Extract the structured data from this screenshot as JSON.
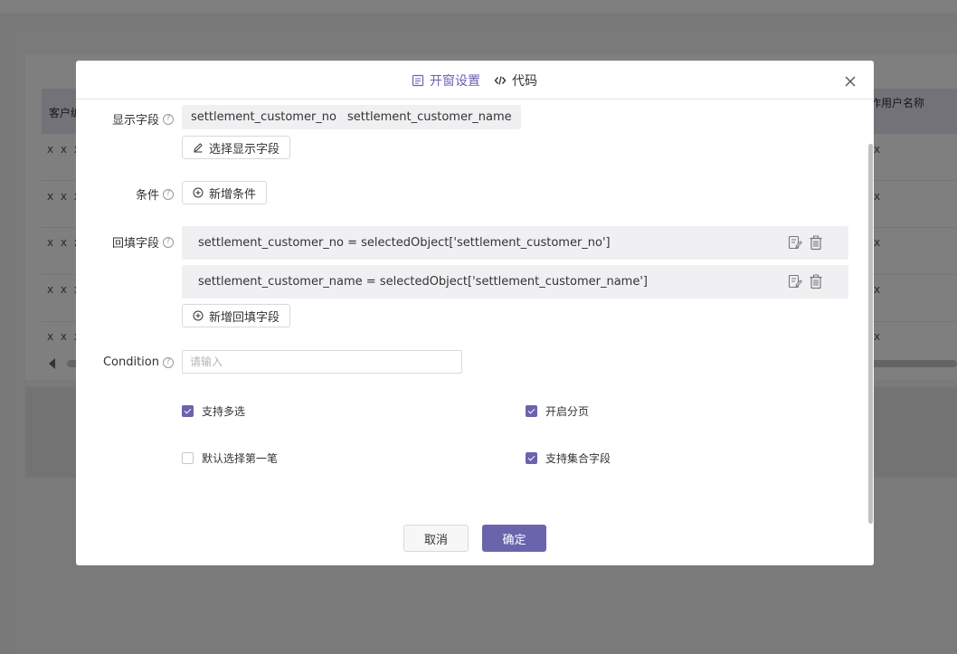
{
  "background": {
    "table_header_left": "客户编",
    "table_header_right": "作用户名称",
    "row_placeholder": "x x x",
    "row_placeholder_right": "x"
  },
  "modal": {
    "tabs": [
      {
        "label": "开窗设置",
        "icon": "document-icon",
        "active": true
      },
      {
        "label": "代码",
        "icon": "code-icon",
        "active": false
      }
    ],
    "close_icon": "close-icon",
    "display_fields": {
      "label": "显示字段",
      "chips": [
        "settlement_customer_no",
        "settlement_customer_name"
      ],
      "select_button": "选择显示字段"
    },
    "conditions": {
      "label": "条件",
      "add_button": "新增条件"
    },
    "backfill_fields": {
      "label": "回填字段",
      "rows": [
        "settlement_customer_no = selectedObject['settlement_customer_no']",
        "settlement_customer_name = selectedObject['settlement_customer_name']"
      ],
      "add_button": "新增回填字段"
    },
    "condition_input": {
      "label": "Condition",
      "placeholder": "请输入",
      "value": ""
    },
    "options": [
      {
        "label": "支持多选",
        "checked": true
      },
      {
        "label": "开启分页",
        "checked": true
      },
      {
        "label": "默认选择第一笔",
        "checked": false
      },
      {
        "label": "支持集合字段",
        "checked": true
      }
    ],
    "footer": {
      "cancel": "取消",
      "confirm": "确定"
    },
    "colors": {
      "accent": "#6a64ad"
    }
  }
}
